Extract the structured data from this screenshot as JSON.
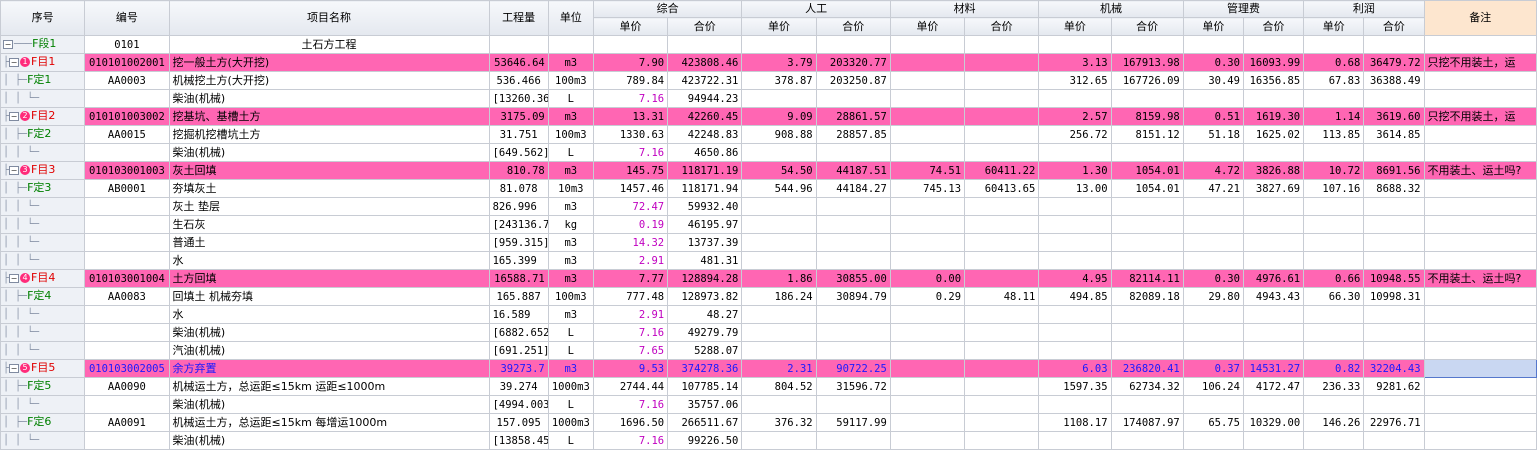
{
  "headers": {
    "seq": "序号",
    "code": "编号",
    "name": "项目名称",
    "qty": "工程量",
    "unit": "单位",
    "groups": [
      "综合",
      "人工",
      "材料",
      "机械",
      "管理费",
      "利润"
    ],
    "price": "单价",
    "total": "合价",
    "remark": "备注"
  },
  "rows": [
    {
      "type": "sec",
      "seq": "F段1",
      "code": "0101",
      "name": "土石方工程",
      "qty": "",
      "unit": "",
      "v": [
        "",
        "",
        "",
        "",
        "",
        "",
        "",
        "",
        "",
        "",
        "",
        ""
      ],
      "remark": ""
    },
    {
      "type": "item",
      "seq": "F目1",
      "num": "1",
      "code": "010101002001",
      "name": "挖一般土方(大开挖)",
      "qty": "53646.64",
      "unit": "m3",
      "v": [
        "7.90",
        "423808.46",
        "3.79",
        "203320.77",
        "",
        "",
        "3.13",
        "167913.98",
        "0.30",
        "16093.99",
        "0.68",
        "36479.72"
      ],
      "remark": "只挖不用装土，运"
    },
    {
      "type": "quota",
      "seq": "F定1",
      "code": "AA0003",
      "name": "机械挖土方(大开挖)",
      "qty": "536.466",
      "unit": "100m3",
      "v": [
        "789.84",
        "423722.31",
        "378.87",
        "203250.87",
        "",
        "",
        "312.65",
        "167726.09",
        "30.49",
        "16356.85",
        "67.83",
        "36388.49"
      ],
      "remark": ""
    },
    {
      "type": "mat",
      "seq": "",
      "code": "",
      "name": "柴油(机械)",
      "qty": "[13260.36",
      "unit": "L",
      "v": [
        "7.16",
        "94944.23",
        "",
        "",
        "",
        "",
        "",
        "",
        "",
        "",
        "",
        ""
      ],
      "remark": ""
    },
    {
      "type": "item",
      "seq": "F目2",
      "num": "2",
      "code": "010101003002",
      "name": "挖基坑、基槽土方",
      "qty": "3175.09",
      "unit": "m3",
      "v": [
        "13.31",
        "42260.45",
        "9.09",
        "28861.57",
        "",
        "",
        "2.57",
        "8159.98",
        "0.51",
        "1619.30",
        "1.14",
        "3619.60"
      ],
      "remark": "只挖不用装土，运"
    },
    {
      "type": "quota",
      "seq": "F定2",
      "code": "AA0015",
      "name": "挖掘机挖槽坑土方",
      "qty": "31.751",
      "unit": "100m3",
      "v": [
        "1330.63",
        "42248.83",
        "908.88",
        "28857.85",
        "",
        "",
        "256.72",
        "8151.12",
        "51.18",
        "1625.02",
        "113.85",
        "3614.85"
      ],
      "remark": ""
    },
    {
      "type": "mat",
      "seq": "",
      "code": "",
      "name": "柴油(机械)",
      "qty": "[649.562]",
      "unit": "L",
      "v": [
        "7.16",
        "4650.86",
        "",
        "",
        "",
        "",
        "",
        "",
        "",
        "",
        "",
        ""
      ],
      "remark": ""
    },
    {
      "type": "item",
      "seq": "F目3",
      "num": "3",
      "code": "010103001003",
      "name": "灰土回填",
      "qty": "810.78",
      "unit": "m3",
      "v": [
        "145.75",
        "118171.19",
        "54.50",
        "44187.51",
        "74.51",
        "60411.22",
        "1.30",
        "1054.01",
        "4.72",
        "3826.88",
        "10.72",
        "8691.56"
      ],
      "remark": "不用装土、运土吗?"
    },
    {
      "type": "quota",
      "seq": "F定3",
      "code": "AB0001",
      "name": "夯填灰土",
      "qty": "81.078",
      "unit": "10m3",
      "v": [
        "1457.46",
        "118171.94",
        "544.96",
        "44184.27",
        "745.13",
        "60413.65",
        "13.00",
        "1054.01",
        "47.21",
        "3827.69",
        "107.16",
        "8688.32"
      ],
      "remark": ""
    },
    {
      "type": "mat",
      "seq": "",
      "code": "",
      "name": "灰土 垫层",
      "qty": "826.996",
      "unit": "m3",
      "v": [
        "72.47",
        "59932.40",
        "",
        "",
        "",
        "",
        "",
        "",
        "",
        "",
        "",
        ""
      ],
      "remark": ""
    },
    {
      "type": "mat",
      "seq": "",
      "code": "",
      "name": "生石灰",
      "qty": "[243136.7",
      "unit": "kg",
      "v": [
        "0.19",
        "46195.97",
        "",
        "",
        "",
        "",
        "",
        "",
        "",
        "",
        "",
        ""
      ],
      "remark": ""
    },
    {
      "type": "mat",
      "seq": "",
      "code": "",
      "name": "普通土",
      "qty": "[959.315]",
      "unit": "m3",
      "v": [
        "14.32",
        "13737.39",
        "",
        "",
        "",
        "",
        "",
        "",
        "",
        "",
        "",
        ""
      ],
      "remark": ""
    },
    {
      "type": "mat",
      "seq": "",
      "code": "",
      "name": "水",
      "qty": "165.399",
      "unit": "m3",
      "v": [
        "2.91",
        "481.31",
        "",
        "",
        "",
        "",
        "",
        "",
        "",
        "",
        "",
        ""
      ],
      "remark": ""
    },
    {
      "type": "item",
      "seq": "F目4",
      "num": "4",
      "code": "010103001004",
      "name": "土方回填",
      "qty": "16588.71",
      "unit": "m3",
      "v": [
        "7.77",
        "128894.28",
        "1.86",
        "30855.00",
        "0.00",
        "",
        "4.95",
        "82114.11",
        "0.30",
        "4976.61",
        "0.66",
        "10948.55"
      ],
      "remark": "不用装土、运土吗?"
    },
    {
      "type": "quota",
      "seq": "F定4",
      "code": "AA0083",
      "name": "回填土 机械夯填",
      "qty": "165.887",
      "unit": "100m3",
      "v": [
        "777.48",
        "128973.82",
        "186.24",
        "30894.79",
        "0.29",
        "48.11",
        "494.85",
        "82089.18",
        "29.80",
        "4943.43",
        "66.30",
        "10998.31"
      ],
      "remark": ""
    },
    {
      "type": "mat",
      "seq": "",
      "code": "",
      "name": "水",
      "qty": "16.589",
      "unit": "m3",
      "v": [
        "2.91",
        "48.27",
        "",
        "",
        "",
        "",
        "",
        "",
        "",
        "",
        "",
        ""
      ],
      "remark": ""
    },
    {
      "type": "mat",
      "seq": "",
      "code": "",
      "name": "柴油(机械)",
      "qty": "[6882.652",
      "unit": "L",
      "v": [
        "7.16",
        "49279.79",
        "",
        "",
        "",
        "",
        "",
        "",
        "",
        "",
        "",
        ""
      ],
      "remark": ""
    },
    {
      "type": "mat",
      "seq": "",
      "code": "",
      "name": "汽油(机械)",
      "qty": "[691.251]",
      "unit": "L",
      "v": [
        "7.65",
        "5288.07",
        "",
        "",
        "",
        "",
        "",
        "",
        "",
        "",
        "",
        ""
      ],
      "remark": ""
    },
    {
      "type": "item",
      "blue": true,
      "seq": "F目5",
      "num": "5",
      "code": "010103002005",
      "name": "余方弃置",
      "qty": "39273.7",
      "unit": "m3",
      "v": [
        "9.53",
        "374278.36",
        "2.31",
        "90722.25",
        "",
        "",
        "6.03",
        "236820.41",
        "0.37",
        "14531.27",
        "0.82",
        "32204.43"
      ],
      "remark": ""
    },
    {
      "type": "quota",
      "seq": "F定5",
      "code": "AA0090",
      "name": "机械运土方，总运距≤15km 运距≤1000m",
      "qty": "39.274",
      "unit": "1000m3",
      "v": [
        "2744.44",
        "107785.14",
        "804.52",
        "31596.72",
        "",
        "",
        "1597.35",
        "62734.32",
        "106.24",
        "4172.47",
        "236.33",
        "9281.62"
      ],
      "remark": ""
    },
    {
      "type": "mat",
      "seq": "",
      "code": "",
      "name": "柴油(机械)",
      "qty": "[4994.003",
      "unit": "L",
      "v": [
        "7.16",
        "35757.06",
        "",
        "",
        "",
        "",
        "",
        "",
        "",
        "",
        "",
        ""
      ],
      "remark": ""
    },
    {
      "type": "quota",
      "seq": "F定6",
      "code": "AA0091",
      "name": "机械运土方，总运距≤15km 每增运1000m",
      "qty": "157.095",
      "unit": "1000m3",
      "v": [
        "1696.50",
        "266511.67",
        "376.32",
        "59117.99",
        "",
        "",
        "1108.17",
        "174087.97",
        "65.75",
        "10329.00",
        "146.26",
        "22976.71"
      ],
      "remark": ""
    },
    {
      "type": "mat",
      "seq": "",
      "code": "",
      "name": "柴油(机械)",
      "qty": "[13858.45",
      "unit": "L",
      "v": [
        "7.16",
        "99226.50",
        "",
        "",
        "",
        "",
        "",
        "",
        "",
        "",
        "",
        ""
      ],
      "remark": ""
    }
  ]
}
